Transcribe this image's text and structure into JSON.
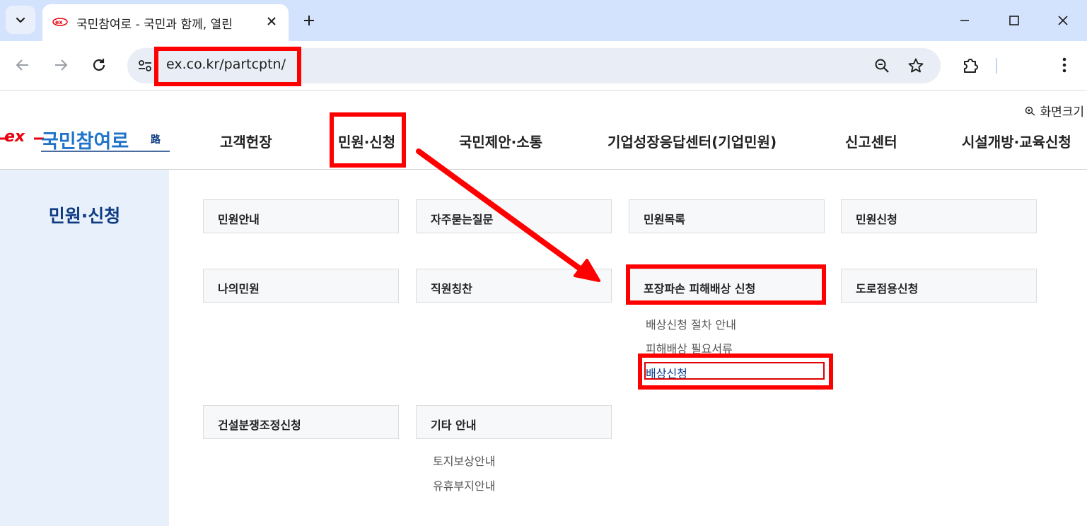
{
  "browser": {
    "tab_title": "국민참여로 - 국민과 함께, 열린",
    "url": "ex.co.kr/partcptn/",
    "icons": [
      "tab-search-icon",
      "favicon-icon",
      "close-icon",
      "plus-icon",
      "minimize-icon",
      "maximize-icon",
      "window-close-icon",
      "back-icon",
      "forward-icon",
      "reload-icon",
      "site-info-icon",
      "zoom-icon",
      "star-icon",
      "extensions-icon",
      "kebab-menu-icon"
    ]
  },
  "header": {
    "screen_size_label": "화면크기",
    "logo_text": "국민참여로",
    "nav": [
      "고객헌장",
      "민원·신청",
      "국민제안·소통",
      "기업성장응답센터(기업민원)",
      "신고센터",
      "시설개방·교육신청"
    ]
  },
  "sidebar": {
    "title": "민원·신청"
  },
  "menus": {
    "row1": [
      "민원안내",
      "자주묻는질문",
      "민원목록",
      "민원신청"
    ],
    "row2": [
      "나의민원",
      "직원칭찬",
      "포장파손 피해배상 신청",
      "도로점용신청"
    ],
    "row2_sub": [
      "배상신청 절차 안내",
      "피해배상 필요서류",
      "배상신청"
    ],
    "row3": [
      "건설분쟁조정신청",
      "기타 안내"
    ],
    "row3_sub": [
      "토지보상안내",
      "유휴부지안내"
    ]
  },
  "colors": {
    "tabstrip": "#d3e3fd",
    "sidebar_bg": "#e8f0fb",
    "sidebar_title": "#0f3c82",
    "highlight": "#ff0000"
  }
}
